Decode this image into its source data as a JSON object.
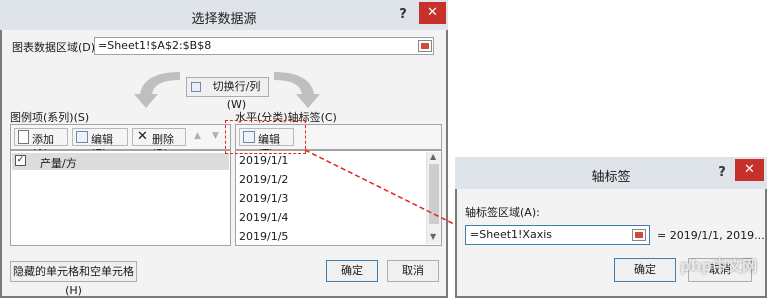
{
  "dialog_select_source": {
    "title": "选择数据源",
    "help": "?",
    "close": "✕",
    "range_label": "图表数据区域(D):",
    "range_value": "=Sheet1!$A$2:$B$8",
    "switch_button": "切换行/列(W)",
    "legend_label": "图例项(系列)(S)",
    "axis_label": "水平(分类)轴标签(C)",
    "legend_toolbar": {
      "add": "添加(A)",
      "edit": "编辑(E)",
      "delete": "删除(R)"
    },
    "axis_toolbar": {
      "edit": "编辑(T)"
    },
    "series": [
      {
        "name": "产量/方",
        "checked": true
      }
    ],
    "axis_items": [
      "2019/1/1",
      "2019/1/2",
      "2019/1/3",
      "2019/1/4",
      "2019/1/5"
    ],
    "hidden_cells_button": "隐藏的单元格和空单元格(H)",
    "ok": "确定",
    "cancel": "取消"
  },
  "dialog_axis_labels": {
    "title": "轴标签",
    "help": "?",
    "close": "✕",
    "range_label": "轴标签区域(A):",
    "range_value": "=Sheet1!Xaxis",
    "preview": "= 2019/1/1, 2019...",
    "ok": "确定",
    "cancel": "取消"
  },
  "watermark": "php中文网",
  "colors": {
    "highlight": "#e0251c",
    "close_button": "#c7312b",
    "selected_row": "#dcdcdc"
  }
}
